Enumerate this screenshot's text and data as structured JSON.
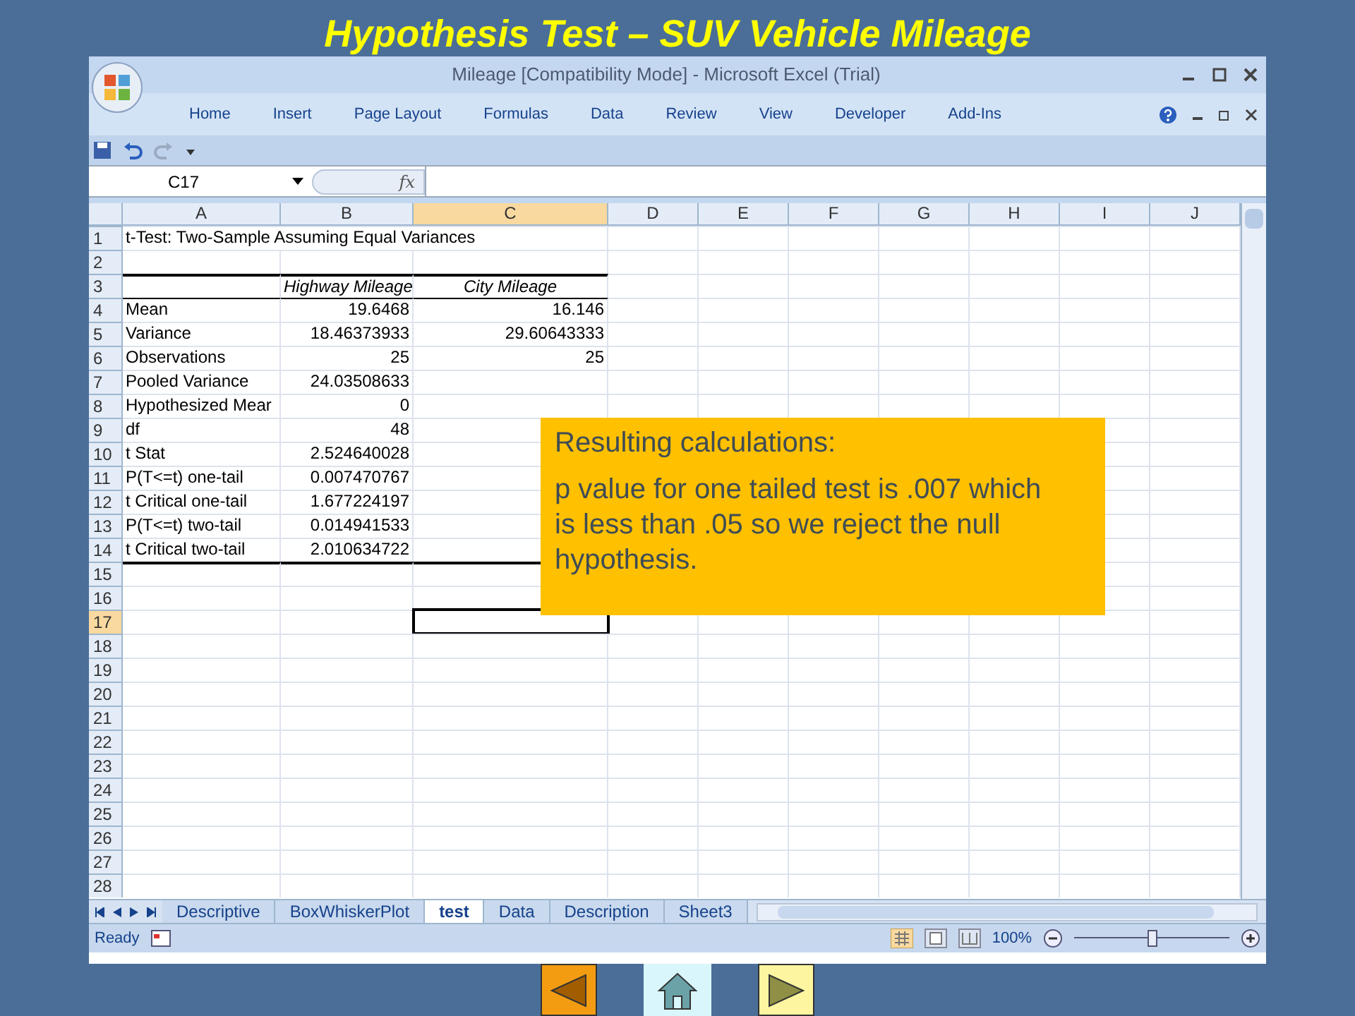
{
  "slide_title": "Hypothesis Test – SUV Vehicle Mileage",
  "window": {
    "title": "Mileage  [Compatibility Mode] - Microsoft Excel (Trial)"
  },
  "ribbon_tabs": [
    "Home",
    "Insert",
    "Page Layout",
    "Formulas",
    "Data",
    "Review",
    "View",
    "Developer",
    "Add-Ins"
  ],
  "name_box": "C17",
  "formula_label": "fx",
  "columns": [
    {
      "label": "A",
      "selected": false
    },
    {
      "label": "B",
      "selected": false
    },
    {
      "label": "C",
      "selected": true
    },
    {
      "label": "D",
      "selected": false
    },
    {
      "label": "E",
      "selected": false
    },
    {
      "label": "F",
      "selected": false
    },
    {
      "label": "G",
      "selected": false
    },
    {
      "label": "H",
      "selected": false
    },
    {
      "label": "I",
      "selected": false
    },
    {
      "label": "J",
      "selected": false
    }
  ],
  "rows": [
    {
      "number": "1",
      "kind": "title",
      "selected": false,
      "cells": [
        "t-Test: Two-Sample Assuming Equal Variances"
      ]
    },
    {
      "number": "2",
      "kind": "empty",
      "selected": false,
      "cells": []
    },
    {
      "number": "3",
      "kind": "header",
      "selected": false,
      "rule_above_thick": true,
      "cells": [
        "",
        "Highway Mileage",
        "City Mileage"
      ]
    },
    {
      "number": "4",
      "kind": "data",
      "selected": false,
      "rule_above_thin": true,
      "cells": [
        "Mean",
        "19.6468",
        "16.146"
      ]
    },
    {
      "number": "5",
      "kind": "data",
      "selected": false,
      "cells": [
        "Variance",
        "18.46373933",
        "29.60643333"
      ]
    },
    {
      "number": "6",
      "kind": "data",
      "selected": false,
      "cells": [
        "Observations",
        "25",
        "25"
      ]
    },
    {
      "number": "7",
      "kind": "data",
      "selected": false,
      "cells": [
        "Pooled Variance",
        "24.03508633"
      ]
    },
    {
      "number": "8",
      "kind": "data",
      "selected": false,
      "cells": [
        "Hypothesized Mear",
        "0"
      ]
    },
    {
      "number": "9",
      "kind": "data",
      "selected": false,
      "cells": [
        "df",
        "48"
      ]
    },
    {
      "number": "10",
      "kind": "data",
      "selected": false,
      "cells": [
        "t Stat",
        "2.524640028"
      ]
    },
    {
      "number": "11",
      "kind": "data",
      "selected": false,
      "cells": [
        "P(T<=t) one-tail",
        "0.007470767"
      ]
    },
    {
      "number": "12",
      "kind": "data",
      "selected": false,
      "cells": [
        "t Critical one-tail",
        "1.677224197"
      ]
    },
    {
      "number": "13",
      "kind": "data",
      "selected": false,
      "cells": [
        "P(T<=t) two-tail",
        "0.014941533"
      ]
    },
    {
      "number": "14",
      "kind": "data",
      "selected": false,
      "cells": [
        "t Critical two-tail",
        "2.010634722"
      ]
    },
    {
      "number": "15",
      "kind": "empty",
      "selected": false,
      "rule_above_thick": true,
      "cells": []
    },
    {
      "number": "16",
      "kind": "empty",
      "selected": false,
      "cells": []
    },
    {
      "number": "17",
      "kind": "empty",
      "selected": true,
      "cells": []
    },
    {
      "number": "18",
      "kind": "empty",
      "selected": false,
      "cells": []
    },
    {
      "number": "19",
      "kind": "empty",
      "selected": false,
      "cells": []
    },
    {
      "number": "20",
      "kind": "empty",
      "selected": false,
      "cells": []
    },
    {
      "number": "21",
      "kind": "empty",
      "selected": false,
      "cells": []
    },
    {
      "number": "22",
      "kind": "empty",
      "selected": false,
      "cells": []
    },
    {
      "number": "23",
      "kind": "empty",
      "selected": false,
      "cells": []
    },
    {
      "number": "24",
      "kind": "empty",
      "selected": false,
      "cells": []
    },
    {
      "number": "25",
      "kind": "empty",
      "selected": false,
      "cells": []
    },
    {
      "number": "26",
      "kind": "empty",
      "selected": false,
      "cells": []
    },
    {
      "number": "27",
      "kind": "empty",
      "selected": false,
      "cells": []
    },
    {
      "number": "28",
      "kind": "empty",
      "selected": false,
      "cells": []
    }
  ],
  "callout": {
    "heading": "Resulting calculations:",
    "text": "p value for one tailed test is .007 which is less than .05 so we reject the null hypothesis."
  },
  "sheet_tabs": [
    {
      "label": "Descriptive",
      "selected": false
    },
    {
      "label": "BoxWhiskerPlot",
      "selected": false
    },
    {
      "label": "test",
      "selected": true
    },
    {
      "label": "Data",
      "selected": false
    },
    {
      "label": "Description",
      "selected": false
    },
    {
      "label": "Sheet3",
      "selected": false
    }
  ],
  "status_bar": {
    "text": "Ready",
    "zoom": "100%",
    "zoom_slider": {
      "level": 0.5
    }
  }
}
